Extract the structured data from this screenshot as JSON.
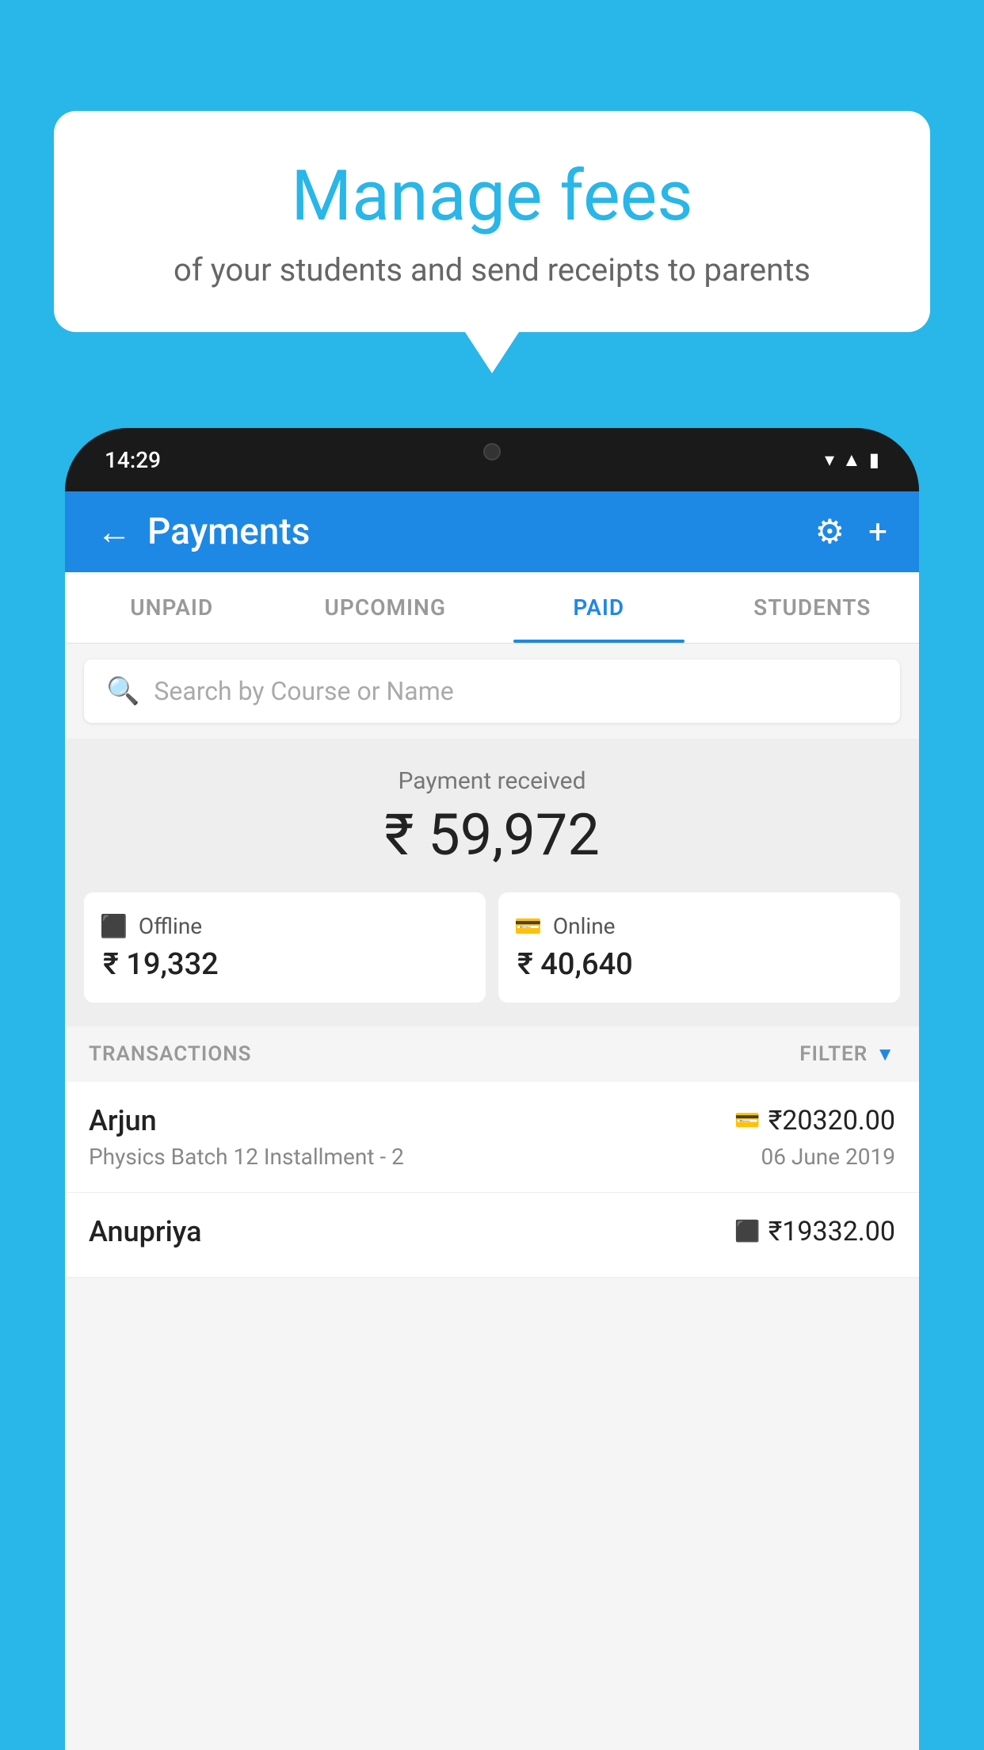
{
  "background_color": "#29b6e8",
  "speech_bubble": {
    "title": "Manage fees",
    "subtitle": "of your students and send receipts to parents"
  },
  "phone": {
    "status_bar": {
      "time": "14:29",
      "icons": [
        "wifi",
        "signal",
        "battery"
      ]
    },
    "header": {
      "title": "Payments",
      "back_label": "←",
      "gear_label": "⚙",
      "plus_label": "+"
    },
    "tabs": [
      {
        "label": "UNPAID",
        "active": false
      },
      {
        "label": "UPCOMING",
        "active": false
      },
      {
        "label": "PAID",
        "active": true
      },
      {
        "label": "STUDENTS",
        "active": false
      }
    ],
    "search": {
      "placeholder": "Search by Course or Name"
    },
    "payment_received": {
      "label": "Payment received",
      "total": "₹ 59,972",
      "offline": {
        "label": "Offline",
        "amount": "₹ 19,332"
      },
      "online": {
        "label": "Online",
        "amount": "₹ 40,640"
      }
    },
    "transactions": {
      "header_label": "TRANSACTIONS",
      "filter_label": "FILTER",
      "items": [
        {
          "name": "Arjun",
          "course": "Physics Batch 12 Installment - 2",
          "amount": "₹20320.00",
          "date": "06 June 2019",
          "payment_type": "online"
        },
        {
          "name": "Anupriya",
          "course": "",
          "amount": "₹19332.00",
          "date": "",
          "payment_type": "offline"
        }
      ]
    }
  }
}
